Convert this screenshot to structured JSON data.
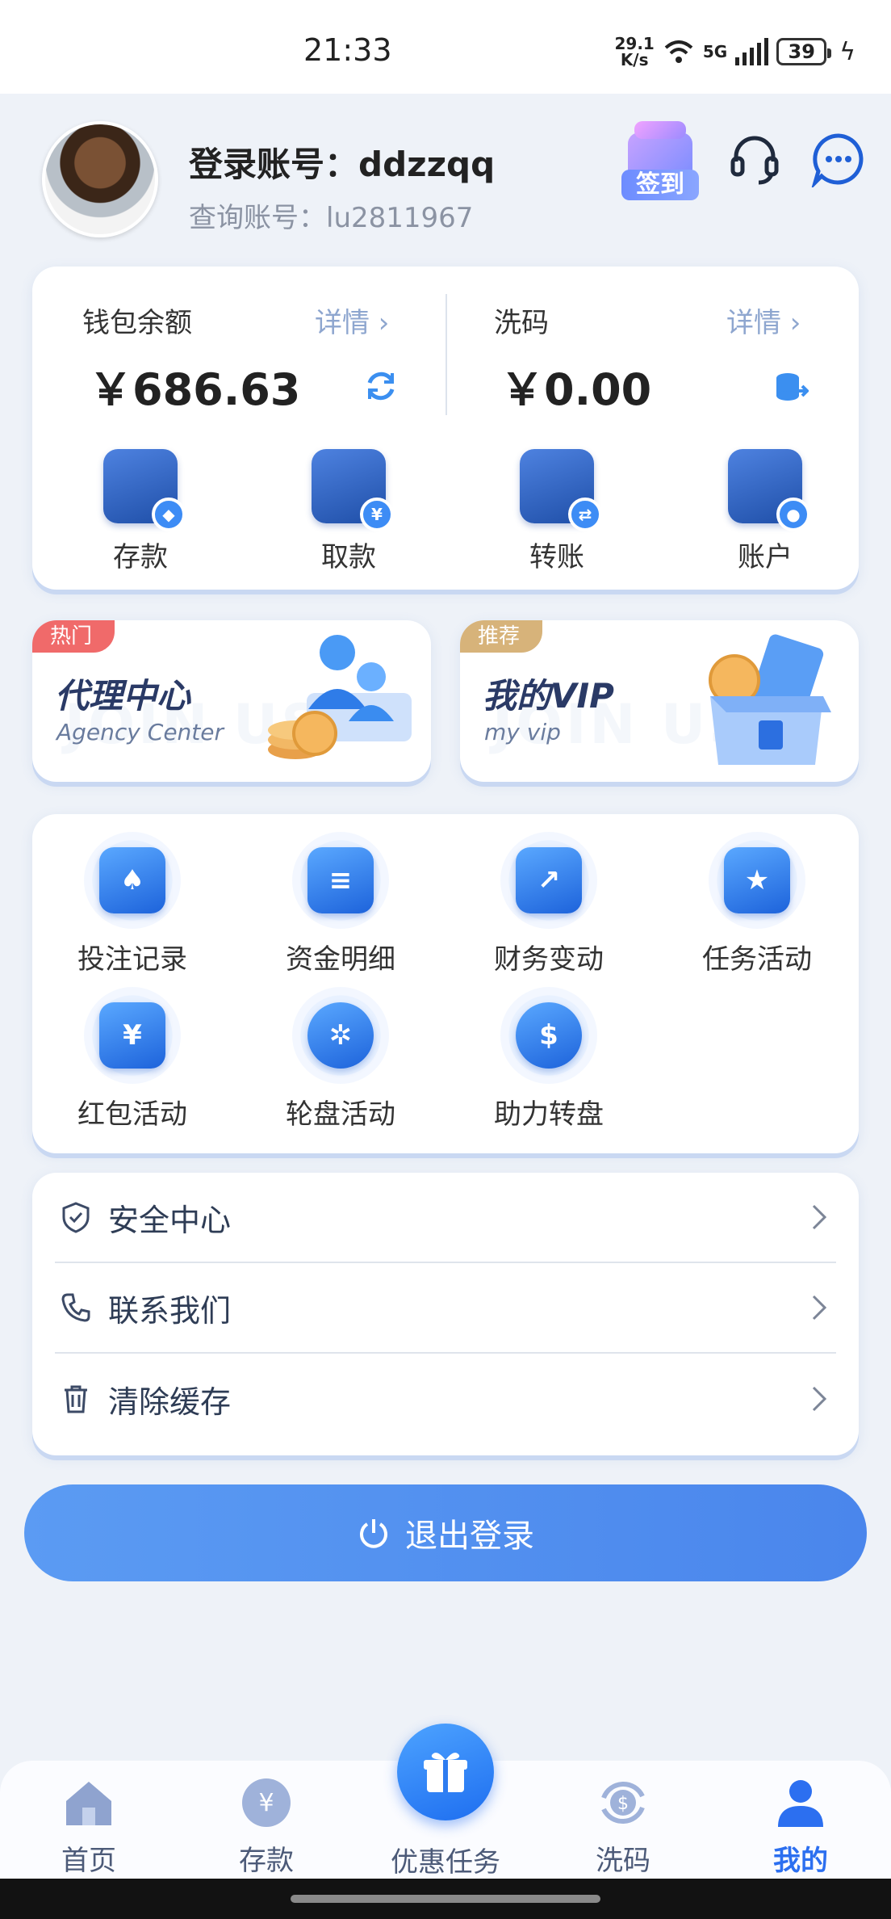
{
  "status_bar": {
    "time": "21:33",
    "net_speed_value": "29.1",
    "net_speed_unit": "K/s",
    "network": "5G",
    "battery": "39"
  },
  "profile": {
    "login_account": "登录账号：ddzzqq",
    "query_account": "查询账号：lu2811967",
    "signin_label": "签到"
  },
  "wallet": {
    "balance_title": "钱包余额",
    "balance_detail": "详情 ›",
    "balance_amount": "￥686.63",
    "wash_title": "洗码",
    "wash_detail": "详情 ›",
    "wash_amount": "￥0.00",
    "actions": [
      {
        "label": "存款",
        "badge": "◆"
      },
      {
        "label": "取款",
        "badge": "¥"
      },
      {
        "label": "转账",
        "badge": "⇄"
      },
      {
        "label": "账户",
        "badge": "●"
      }
    ]
  },
  "promos": [
    {
      "tag": "热门",
      "title": "代理中心",
      "subtitle": "Agency Center",
      "bg_text": "JOIN US",
      "tag_color": "#f06a6a"
    },
    {
      "tag": "推荐",
      "title": "我的VIP",
      "subtitle": "my vip",
      "bg_text": "JOIN US",
      "tag_color": "#d7b37a"
    }
  ],
  "grid": [
    {
      "label": "投注记录",
      "glyph": "♠"
    },
    {
      "label": "资金明细",
      "glyph": "≡"
    },
    {
      "label": "财务变动",
      "glyph": "↗"
    },
    {
      "label": "任务活动",
      "glyph": "★"
    },
    {
      "label": "红包活动",
      "glyph": "¥"
    },
    {
      "label": "轮盘活动",
      "glyph": "✲"
    },
    {
      "label": "助力转盘",
      "glyph": "$"
    }
  ],
  "menu": [
    {
      "label": "安全中心"
    },
    {
      "label": "联系我们"
    },
    {
      "label": "清除缓存"
    }
  ],
  "logout_label": "退出登录",
  "tabs": [
    {
      "label": "首页"
    },
    {
      "label": "存款"
    },
    {
      "label": "优惠任务"
    },
    {
      "label": "洗码"
    },
    {
      "label": "我的"
    }
  ],
  "colors": {
    "accent": "#2c6ff0",
    "background": "#eef2f8",
    "logout": "#4a86ec"
  }
}
